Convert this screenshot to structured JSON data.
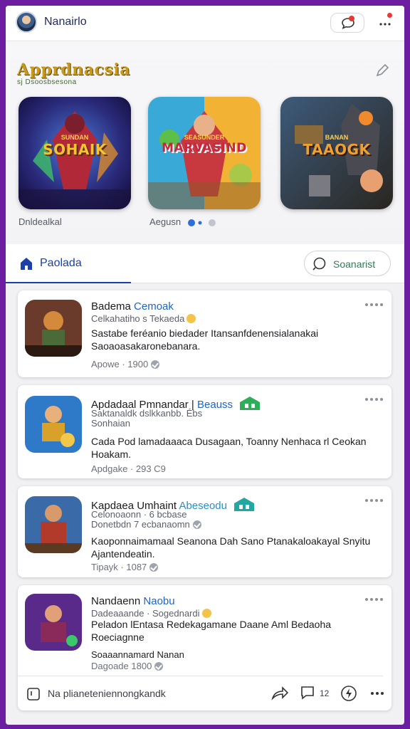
{
  "header": {
    "app_title": "Nanairlo",
    "notifications_icon": "chat-bubble-icon",
    "more_icon": "more-dots-icon"
  },
  "featured": {
    "title": "Apprdnacsia",
    "subtitle": "sj Dsoosbsesona",
    "edit_icon": "pencil-icon",
    "tiles": [
      {
        "logo_top": "SUNDAN",
        "logo": "SOHAIK",
        "caption": "Dnldealkal",
        "logo_color": "#f4c531"
      },
      {
        "logo_top": "SEASUNDER",
        "logo": "MARVASIND",
        "caption": "Aegusn",
        "logo_color": "#c7283f"
      },
      {
        "logo_top": "BANAN",
        "logo": "TAAOGK",
        "caption": "",
        "logo_color": "#f0a030"
      }
    ]
  },
  "tabs": {
    "active_label": "Paolada",
    "search_label": "Soanarist"
  },
  "feed": [
    {
      "name": "Badema",
      "name_accent": "Cemoak",
      "meta": "Celkahatiho s Tekaeda",
      "meta2": "",
      "desc": "Sastabe feréanio biedader Itansanfdenensialanakai Saoaoasakaronebanara.",
      "foot": "Apowe · 1900"
    },
    {
      "name": "Apdadaal Pmnandar |",
      "name_accent": "Beauss",
      "meta": "Saktanaldk dslkkanbb. Ébs",
      "meta2": "Sonhaian",
      "desc": "Cada Pod lamadaaaca Dusagaan, Toanny Nenhaca rl Ceokan Hoakam.",
      "foot": "Apdgake · 293 C9"
    },
    {
      "name": "Kapdaea Umhaint",
      "name_accent": "Abeseodu",
      "meta": "Celonoaonn · 6 bcbase",
      "meta2": "Donetbdn 7 ecbanaomn",
      "desc": "Kaoponnaimamaal Seanona Dah Sano Ptanakaloakayal Snyitu Ajantendeatin.",
      "foot": "Tipayk · 1087"
    },
    {
      "name": "Nandaenn",
      "name_accent": "Naobu",
      "meta": "Dadeaaande · Sogednardi",
      "meta2": "",
      "desc": "Peladon lEntasa Redekagamane Daane Aml Bedaoha Roeciagnne",
      "foot": "Soaaannamard Nanan",
      "foot2": "Dagoade 1800"
    }
  ],
  "action_bar": {
    "compose_label": "Na plianeteniennongkandk",
    "count": "12"
  },
  "colors": {
    "brand_purple": "#6b1fa0",
    "accent_blue": "#1c3fa8",
    "accent_green": "#2e7d57"
  }
}
